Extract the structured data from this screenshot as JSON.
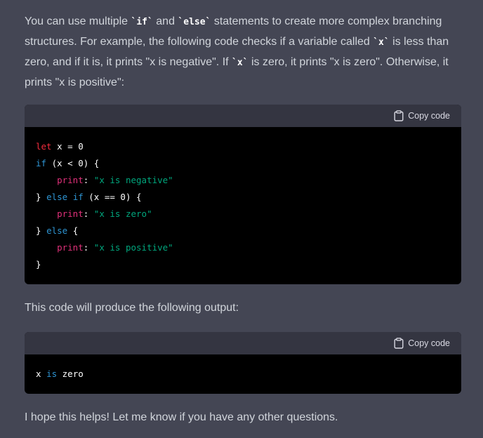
{
  "intro": {
    "t1": "You can use multiple ",
    "c1": "`if`",
    "t2": " and ",
    "c2": "`else`",
    "t3": " statements to create more complex branching structures. For example, the following code checks if a variable called ",
    "c3": "`x`",
    "t4": " is less than zero, and if it is, it prints \"x is negative\". If ",
    "c4": "`x`",
    "t5": " is zero, it prints \"x is zero\". Otherwise, it prints \"x is positive\":"
  },
  "code_block_1": {
    "copy_label": "Copy code",
    "lines": {
      "l1_kw": "let",
      "l1_rest": " x = 0",
      "l2_kw": "if",
      "l2_rest": " (x < 0) {",
      "l3_indent": "    ",
      "l3_fn": "print",
      "l3_sep": ": ",
      "l3_str": "\"x is negative\"",
      "l4_a": "} ",
      "l4_kw": "else if",
      "l4_rest": " (x == 0) {",
      "l5_indent": "    ",
      "l5_fn": "print",
      "l5_sep": ": ",
      "l5_str": "\"x is zero\"",
      "l6_a": "} ",
      "l6_kw": "else",
      "l6_rest": " {",
      "l7_indent": "    ",
      "l7_fn": "print",
      "l7_sep": ": ",
      "l7_str": "\"x is positive\"",
      "l8": "}"
    }
  },
  "output_intro": "This code will produce the following output:",
  "code_block_2": {
    "copy_label": "Copy code",
    "w1": "x ",
    "w2": "is",
    "w3": " zero"
  },
  "closing": "I hope this helps! Let me know if you have any other questions.",
  "colors": {
    "background": "#444654",
    "code_bg": "#000000",
    "code_header": "#343541",
    "keyword": "#2e95d3",
    "let_keyword": "#f22c3d",
    "function": "#df3079",
    "string": "#00a67d"
  },
  "icons": {
    "copy": "clipboard-icon"
  }
}
